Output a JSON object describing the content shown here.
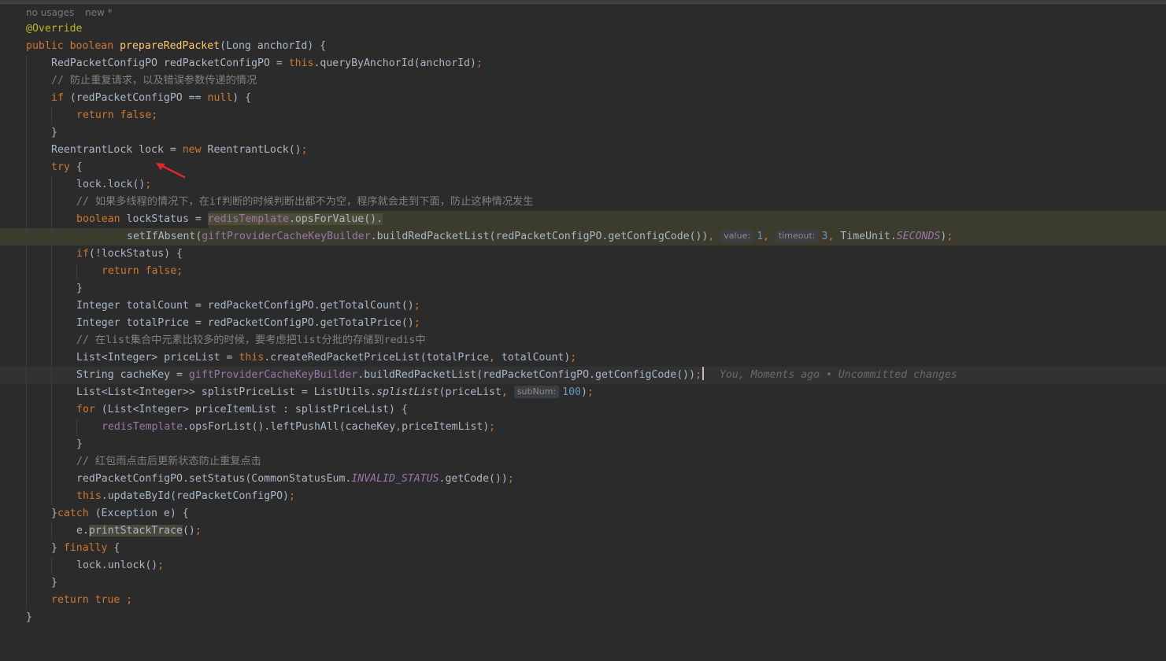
{
  "hints": {
    "usages": "no usages",
    "status": "new *"
  },
  "lines": {
    "l1": "@Override",
    "l2a": "public boolean ",
    "l2b": "prepareRedPacket",
    "l2c": "(Long anchorId) {",
    "l3a": "RedPacketConfigPO redPacketConfigPO = ",
    "l3b": "this",
    "l3c": ".queryByAnchorId(anchorId)",
    "l3d": ";",
    "l4": "// 防止重复请求，以及错误参数传递的情况",
    "l5a": "if",
    "l5b": " (redPacketConfigPO == ",
    "l5c": "null",
    "l5d": ") {",
    "l6": "return false;",
    "l7": "}",
    "l8a": "ReentrantLock lock = ",
    "l8b": "new",
    "l8c": " ReentrantLock()",
    "l8d": ";",
    "l9a": "try",
    "l9b": " {",
    "l10a": "lock.lock()",
    "l10b": ";",
    "l11": "// 如果多线程的情况下，在if判断的时候判断出都不为空，程序就会走到下面，防止这种情况发生",
    "l12a": "boolean",
    "l12b": " lockStatus = ",
    "l12c": "redisTemplate",
    "l12d": ".opsForValue().",
    "l13a": "setIfAbsent(",
    "l13b": "giftProviderCacheKeyBuilder",
    "l13c": ".buildRedPacketList(redPacketConfigPO.getConfigCode())",
    "l13d": ", ",
    "l13_hint1": "value:",
    "l13_v1": "1",
    "l13_sep": ", ",
    "l13_hint2": "timeout:",
    "l13_v2": "3",
    "l13_sep2": ", ",
    "l13e": "TimeUnit.",
    "l13f": "SECONDS",
    "l13g": ")",
    "l13h": ";",
    "l14a": "if",
    "l14b": "(!lockStatus) {",
    "l15": "return false;",
    "l16": "}",
    "l17a": "Integer totalCount = redPacketConfigPO.getTotalCount()",
    "l17b": ";",
    "l18a": "Integer totalPrice = redPacketConfigPO.getTotalPrice()",
    "l18b": ";",
    "l19": "// 在list集合中元素比较多的时候，要考虑把list分批的存储到redis中",
    "l20a": "List<Integer> priceList = ",
    "l20b": "this",
    "l20c": ".createRedPacketPriceList(totalPrice",
    "l20d": ", ",
    "l20e": "totalCount)",
    "l20f": ";",
    "l21a": "String cacheKey = ",
    "l21b": "giftProviderCacheKeyBuilder",
    "l21c": ".buildRedPacketList(redPacketConfigPO.getConfigCode())",
    "l21d": ";",
    "l21_blame": "You, Moments ago • Uncommitted changes",
    "l22a": "List<List<Integer>> splistPriceList = ListUtils.",
    "l22b": "splistList",
    "l22c": "(priceList",
    "l22d": ", ",
    "l22_hint": "subNum:",
    "l22_v": "100",
    "l22e": ")",
    "l22f": ";",
    "l23a": "for",
    "l23b": " (List<Integer> priceItemList : splistPriceList) {",
    "l24a": "redisTemplate",
    "l24b": ".opsForList().leftPushAll(cacheKey",
    "l24c": ",",
    "l24d": "priceItemList)",
    "l24e": ";",
    "l25": "}",
    "l26": "// 红包雨点击后更新状态防止重复点击",
    "l27a": "redPacketConfigPO.setStatus(CommonStatusEum.",
    "l27b": "INVALID_STATUS",
    "l27c": ".getCode())",
    "l27d": ";",
    "l28a": "this",
    "l28b": ".updateById(redPacketConfigPO)",
    "l28c": ";",
    "l29a": "}",
    "l29b": "catch",
    "l29c": " (Exception e) {",
    "l30a": "e.",
    "l30b": "printStackTrace",
    "l30c": "()",
    "l30d": ";",
    "l31a": "} ",
    "l31b": "finally",
    "l31c": " {",
    "l32a": "lock.unlock()",
    "l32b": ";",
    "l33": "}",
    "l34": "return true ;",
    "l35": "}"
  },
  "colors": {
    "background": "#2b2b2b",
    "keyword": "#cc7832",
    "annotation": "#bbb529",
    "method": "#ffc66d",
    "comment": "#808080",
    "field": "#9876aa",
    "number": "#6897bb",
    "arrow": "#e0262a"
  }
}
